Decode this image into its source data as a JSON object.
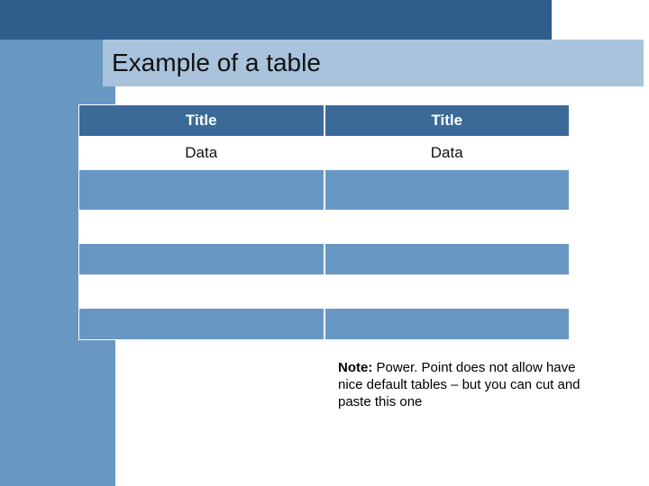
{
  "slide": {
    "title": "Example of a table"
  },
  "table": {
    "headers": [
      "Title",
      "Title"
    ],
    "rows": [
      [
        "Data",
        "Data"
      ],
      [
        "",
        ""
      ],
      [
        "",
        ""
      ],
      [
        "",
        ""
      ],
      [
        "",
        ""
      ],
      [
        "",
        ""
      ]
    ]
  },
  "note": {
    "label": "Note:",
    "text": " Power. Point does not allow have nice default tables – but you can cut and paste this one"
  }
}
